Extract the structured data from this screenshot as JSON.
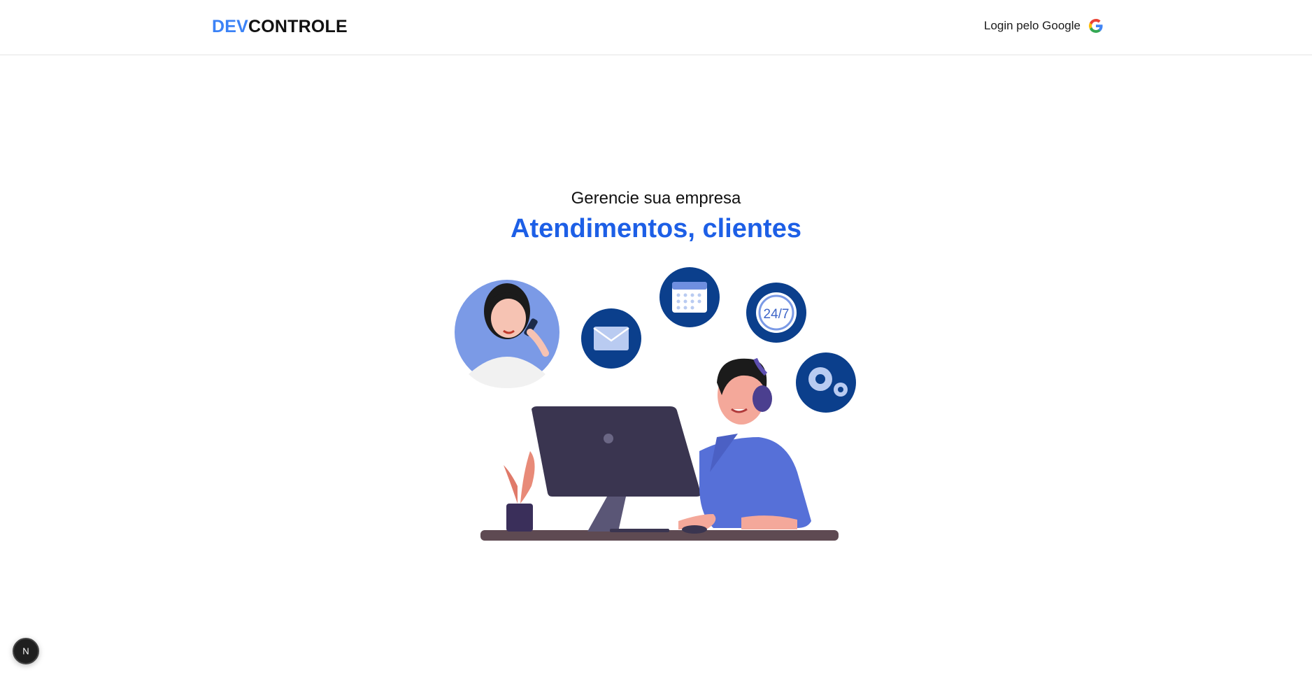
{
  "header": {
    "logo_prefix": "DEV",
    "logo_suffix": "CONTROLE",
    "login_label": "Login pelo Google",
    "login_icon": "google-icon"
  },
  "hero": {
    "subtitle": "Gerencie sua empresa",
    "title": "Atendimentos, clientes"
  },
  "illustration": {
    "clock_text": "24/7"
  },
  "dev_badge": {
    "letter": "N",
    "icon": "nextjs-icon"
  },
  "colors": {
    "brand_blue": "#3b82f6",
    "title_blue": "#1d5fe6",
    "icon_circle": "#0b3f8c"
  }
}
